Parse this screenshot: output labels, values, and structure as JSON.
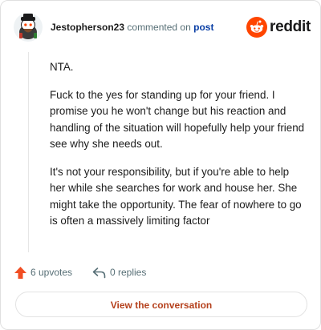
{
  "header": {
    "author": "Jestopherson23",
    "commented_text": "commented on",
    "post_link": "post",
    "brand": "reddit"
  },
  "comment": {
    "paragraphs": [
      "NTA.",
      "Fuck to the yes for standing up for your friend. I promise you he won't change but his reaction and handling of the situation will hopefully help your friend see why she needs out.",
      "It's not your responsibility, but if you're able to help her while she searches for work and house her. She might take the opportunity. The fear of nowhere to go is often a massively limiting factor"
    ]
  },
  "footer": {
    "upvotes_label": "6 upvotes",
    "replies_label": "0 replies"
  },
  "cta": {
    "label": "View the conversation"
  },
  "colors": {
    "reddit_orange": "#ff4500",
    "upvote_orange": "#f14e23",
    "link_blue": "#0a3fa5",
    "cta_text": "#b5401c",
    "muted_text": "#576f76"
  },
  "icons": {
    "avatar": "snoo-avatar",
    "brand": "reddit-logo-icon",
    "upvote": "upvote-arrow-icon",
    "reply": "reply-arrow-icon"
  }
}
